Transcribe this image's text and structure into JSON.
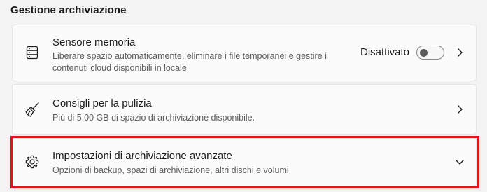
{
  "section": {
    "title": "Gestione archiviazione"
  },
  "items": [
    {
      "title": "Sensore memoria",
      "description_line1": "Liberare spazio automaticamente, eliminare i file temporanei e gestire i",
      "description_line2": "contenuti cloud disponibili in locale",
      "status": "Disattivato",
      "toggle_on": false,
      "icon": "storage-drive-icon",
      "trailing_icon": "chevron-right-icon"
    },
    {
      "title": "Consigli per la pulizia",
      "description": "Più di 5,00 GB di spazio di archiviazione disponibile.",
      "icon": "broom-icon",
      "trailing_icon": "chevron-right-icon"
    },
    {
      "title": "Impostazioni di archiviazione avanzate",
      "description": "Opzioni di backup, spazi di archiviazione, altri dischi e volumi",
      "icon": "gear-icon",
      "trailing_icon": "chevron-down-icon",
      "highlighted": true
    }
  ],
  "colors": {
    "background": "#f3f3f3",
    "card": "#fbfbfb",
    "highlight": "#e1151f",
    "secondary_text": "#5d5d5d"
  }
}
